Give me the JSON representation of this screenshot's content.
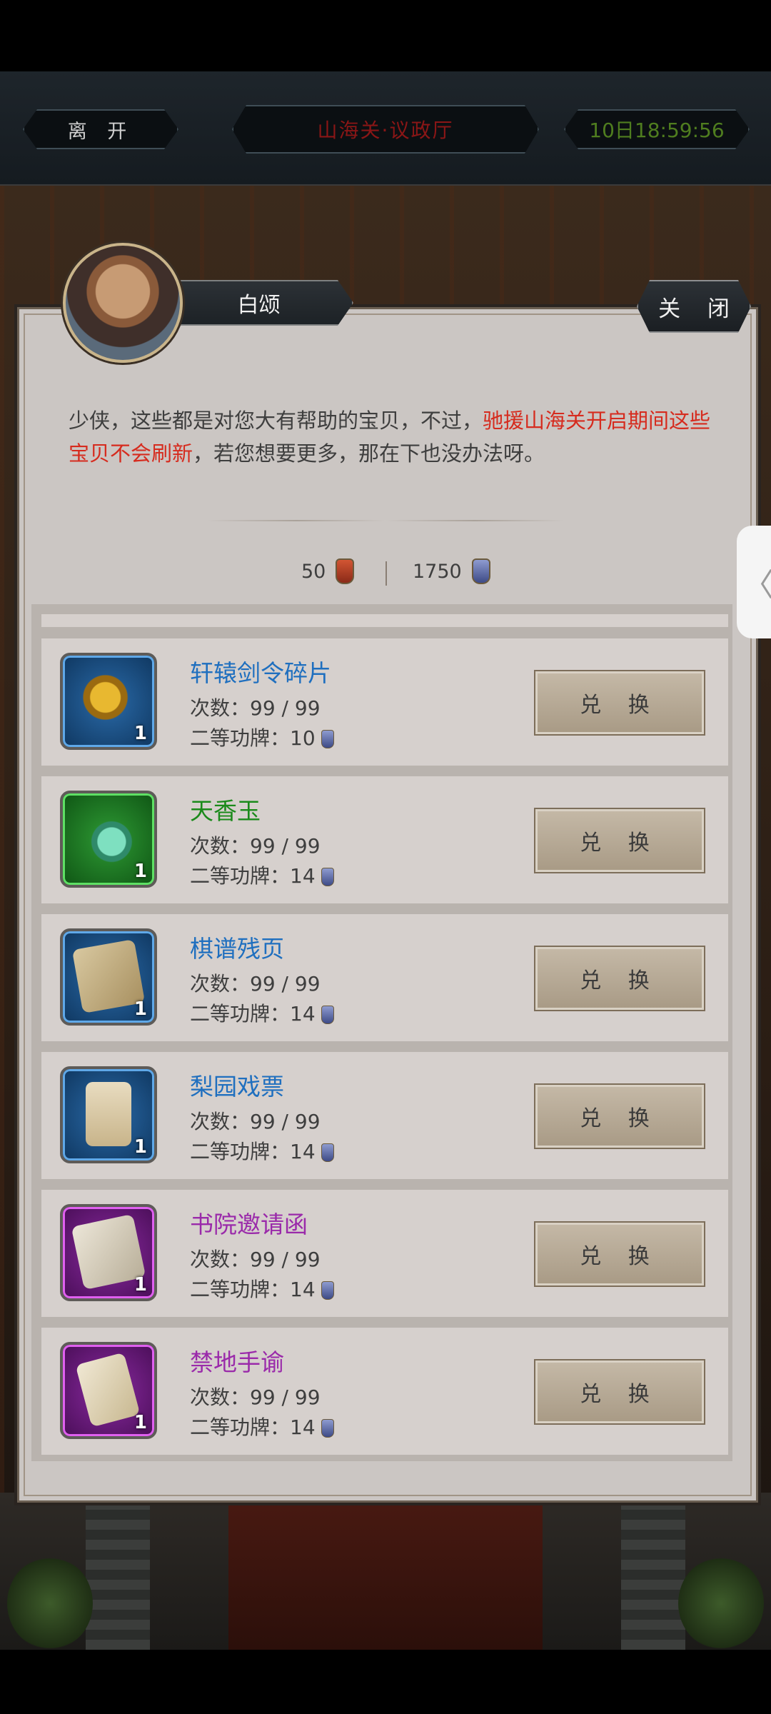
{
  "topbar": {
    "leave_label": "离 开",
    "location": "山海关·议政厅",
    "time": "10日18:59:56"
  },
  "dialog": {
    "npc_name": "白颂",
    "close_label": "关 闭",
    "desc_part1": "少侠，这些都是对您大有帮助的宝贝，不过，",
    "desc_red": "驰援山海关开启期间这些宝贝不会刷新",
    "desc_part2": "，若您想要更多，那在下也没办法呀。",
    "currency1": "50",
    "currency2": "1750"
  },
  "items": [
    {
      "name": "轩辕剑令碎片",
      "quality": "blue",
      "count": "1",
      "times_label": "次数：",
      "times": "99 / 99",
      "cost_label": "二等功牌：",
      "cost": "10",
      "button": "兑 换"
    },
    {
      "name": "天香玉",
      "quality": "green",
      "count": "1",
      "times_label": "次数：",
      "times": "99 / 99",
      "cost_label": "二等功牌：",
      "cost": "14",
      "button": "兑 换"
    },
    {
      "name": "棋谱残页",
      "quality": "blue",
      "count": "1",
      "times_label": "次数：",
      "times": "99 / 99",
      "cost_label": "二等功牌：",
      "cost": "14",
      "button": "兑 换"
    },
    {
      "name": "梨园戏票",
      "quality": "blue",
      "count": "1",
      "times_label": "次数：",
      "times": "99 / 99",
      "cost_label": "二等功牌：",
      "cost": "14",
      "button": "兑 换"
    },
    {
      "name": "书院邀请函",
      "quality": "purple",
      "count": "1",
      "times_label": "次数：",
      "times": "99 / 99",
      "cost_label": "二等功牌：",
      "cost": "14",
      "button": "兑 换"
    },
    {
      "name": "禁地手谕",
      "quality": "purple",
      "count": "1",
      "times_label": "次数：",
      "times": "99 / 99",
      "cost_label": "二等功牌：",
      "cost": "14",
      "button": "兑 换"
    }
  ],
  "sidetab_glyph": "〈",
  "colors": {
    "blue_quality": "#1f6fbf",
    "green_quality": "#1b8a1b",
    "purple_quality": "#9a2aaa",
    "highlight_red": "#d62b1e"
  }
}
